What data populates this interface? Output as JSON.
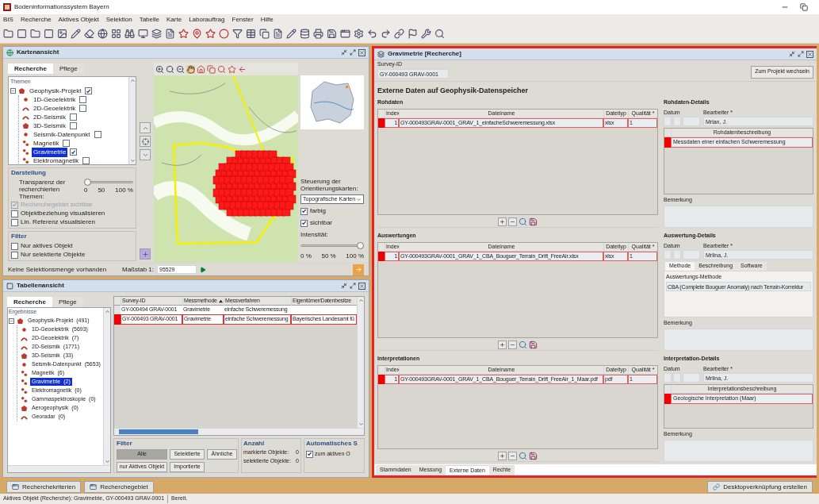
{
  "window": {
    "title": "Bodeninformationssystem Bayern"
  },
  "menu": [
    "BIS",
    "Recherche",
    "Aktives Objekt",
    "Selektion",
    "Tabelle",
    "Karte",
    "Laborauftrag",
    "Fenster",
    "Hilfe"
  ],
  "map_view": {
    "title": "Kartenansicht",
    "tabs": [
      {
        "label": "Recherche",
        "selected": true
      },
      {
        "label": "Pflege",
        "selected": false
      }
    ],
    "themes_label": "Themen",
    "themes": [
      {
        "label": "Geophysik-Projekt",
        "checked": true,
        "selected": false,
        "children": [
          {
            "label": "1D-Geoelektrik",
            "checked": false,
            "selected": false
          },
          {
            "label": "2D-Geoelektrik",
            "checked": false,
            "selected": false
          },
          {
            "label": "2D-Seismik",
            "checked": false,
            "selected": false
          },
          {
            "label": "3D-Seismik",
            "checked": false,
            "selected": false
          },
          {
            "label": "Seismik-Datenpunkt",
            "checked": false,
            "selected": false
          },
          {
            "label": "Magnetik",
            "checked": false,
            "selected": false
          },
          {
            "label": "Gravimetrie",
            "checked": true,
            "selected": true
          },
          {
            "label": "Elektromagnetik",
            "checked": false,
            "selected": false
          }
        ]
      }
    ],
    "display": {
      "title": "Darstellung",
      "transparency": {
        "label": "Transparenz der recherchierten Themen:",
        "level": 0,
        "ticks": [
          "0",
          "50",
          "100 %"
        ]
      },
      "options": [
        {
          "label": "Recherchegebiet sichtbar",
          "checked": true,
          "disabled": true
        },
        {
          "label": "Objektbeziehung visualisieren",
          "checked": false,
          "disabled": false
        },
        {
          "label": "Lin. Referenz visualisieren",
          "checked": false,
          "disabled": false
        }
      ]
    },
    "filter": {
      "title": "Filter",
      "options": [
        {
          "label": "Nur aktives Objekt",
          "checked": false
        },
        {
          "label": "Nur selektierte Objekte",
          "checked": false
        }
      ]
    },
    "orientation": {
      "label": "Steuerung der Orientierungskarten:",
      "map_type": "Topografische Karten",
      "options": [
        {
          "label": "farbig",
          "checked": true
        },
        {
          "label": "sichtbar",
          "checked": true
        }
      ],
      "intensity": {
        "label": "Intensität:",
        "level": 1,
        "ticks": [
          "0 %",
          "50 %",
          "100 %"
        ]
      }
    },
    "selection_status": "Keine Selektionsmenge vorhanden",
    "scale": {
      "label": "Maßstab 1:",
      "value": "95529"
    }
  },
  "table_view": {
    "title": "Tabellenansicht",
    "tabs": [
      {
        "label": "Recherche",
        "selected": true
      },
      {
        "label": "Pflege",
        "selected": false
      }
    ],
    "results_label": "Ergebnisse",
    "tree": [
      {
        "label": "Geophysik-Projekt",
        "count": "(491)",
        "selected": false,
        "children": [
          {
            "label": "1D-Geoelektrik",
            "count": "(5693)",
            "selected": false
          },
          {
            "label": "2D-Geoelektrik",
            "count": "(7)",
            "selected": false
          },
          {
            "label": "2D-Seismik",
            "count": "(1771)",
            "selected": false
          },
          {
            "label": "3D-Seismik",
            "count": "(33)",
            "selected": false
          },
          {
            "label": "Seismik-Datenpunkt",
            "count": "(5653)",
            "selected": false
          },
          {
            "label": "Magnetik",
            "count": "(6)",
            "selected": false
          },
          {
            "label": "Gravimetrie",
            "count": "(2)",
            "selected": true
          },
          {
            "label": "Elektromagnetik",
            "count": "(0)",
            "selected": false
          },
          {
            "label": "Gammaspektroskopie",
            "count": "(0)",
            "selected": false
          },
          {
            "label": "Aerogeophysik",
            "count": "(0)",
            "selected": false
          },
          {
            "label": "Georadar",
            "count": "(0)",
            "selected": false
          }
        ]
      }
    ],
    "table": {
      "columns": [
        {
          "label": "Survey-ID",
          "sorted": false
        },
        {
          "label": "Messmethode",
          "sorted": true
        },
        {
          "label": "Messverfahren",
          "sorted": false
        },
        {
          "label": "Eigentümer/Datenbesitze",
          "sorted": false
        }
      ],
      "rows": [
        {
          "active": false,
          "survey_id": "GY-000494 GRAV-0001",
          "method": "Gravimetrie",
          "procedure": "einfache Schweremessung"
        },
        {
          "active": true,
          "survey_id": "GY-000493 GRAV-0001",
          "method": "Gravimetrie",
          "procedure": "einfache Schweremessung",
          "owner": "Bayerisches Landesamt fü"
        }
      ]
    },
    "filter": {
      "title": "Filter",
      "buttons": [
        {
          "label": "Alle",
          "selected": true
        },
        {
          "label": "Selektierte",
          "selected": false
        },
        {
          "label": "Ähnliche",
          "selected": false
        },
        {
          "label": "nur Aktives Objekt",
          "selected": false
        },
        {
          "label": "Importierte",
          "selected": false
        }
      ]
    },
    "count": {
      "title": "Anzahl",
      "items": [
        {
          "label": "markierte Objekte:",
          "value": "0"
        },
        {
          "label": "selektierte Objekte:",
          "value": "0"
        }
      ]
    },
    "auto": {
      "title": "Automatisches S",
      "option": {
        "label": "zum aktiven O",
        "checked": true
      }
    }
  },
  "detail": {
    "title": "Gravimetrie [Recherche]",
    "survey_id_label": "Survey-ID",
    "survey_id": "GY-000493 GRAV-0001",
    "project_button": "Zum Projekt wechseln",
    "heading": "Externe Daten auf Geophysik-Datenspeicher",
    "sections": [
      {
        "title": "Rohdaten",
        "columns": [
          "Index",
          "Dateiname",
          "Dateityp",
          "Qualität *"
        ],
        "rows": [
          {
            "active": true,
            "cells": [
              "1",
              "GY-000493GRAV-0001_GRAV_1_einfacheSchweremessung.xlsx",
              "xlsx",
              "1"
            ]
          }
        ],
        "details": {
          "kind": "description",
          "title": "Rohdaten-Details",
          "date_label": "Datum",
          "editor_label": "Bearbeiter *",
          "editor": "Mrlan, J.",
          "table_header": "Rohdatenbeschreibung",
          "rows": [
            {
              "active": true,
              "text": "Messdaten einer einfachen Schweremessung"
            }
          ],
          "remark_label": "Bemerkung"
        }
      },
      {
        "title": "Auswertungen",
        "columns": [
          "Index",
          "Dateiname",
          "Dateityp",
          "Qualität *"
        ],
        "rows": [
          {
            "active": true,
            "cells": [
              "1",
              "GY-000493GRAV-0001_GRAV_1_CBA_Bouguer_Terrain_Drift_FreeAir.xlsx",
              "xlsx",
              "1"
            ]
          }
        ],
        "details": {
          "kind": "method",
          "title": "Auswertung-Details",
          "date_label": "Datum",
          "editor_label": "Bearbeiter *",
          "editor": "Mrlina, J.",
          "tabs": [
            {
              "label": "Methode",
              "selected": true
            },
            {
              "label": "Beschreibung",
              "selected": false
            },
            {
              "label": "Software",
              "selected": false
            }
          ],
          "method_label": "Auswertungs-Methode",
          "method": "CBA (Complete Bouguer Anomaly) nach Terrain-Korrektur",
          "remark_label": "Bemerkung"
        }
      },
      {
        "title": "Interpretationen",
        "columns": [
          "Index",
          "Dateiname",
          "Dateityp",
          "Qualität *"
        ],
        "rows": [
          {
            "active": true,
            "cells": [
              "1",
              "GY-000493GRAV-0001_GRAV_1_CBA_Bouguer_Terrain_Drift_FreeAir_1_Maar.pdf",
              "pdf",
              "1"
            ]
          }
        ],
        "details": {
          "kind": "description",
          "title": "Interpretation-Details",
          "date_label": "Datum",
          "editor_label": "Bearbeiter *",
          "editor": "Mrlina, J.",
          "table_header": "Interpretationsbeschreibung",
          "rows": [
            {
              "active": true,
              "text": "Geologische Interpretation (Maar)"
            }
          ],
          "remark_label": "Bemerkung"
        }
      }
    ],
    "tabs": [
      {
        "label": "Stammdaten",
        "selected": false
      },
      {
        "label": "Messung",
        "selected": false
      },
      {
        "label": "Externe Daten",
        "selected": true
      },
      {
        "label": "Rechte",
        "selected": false
      }
    ]
  },
  "bottom_tabs": [
    "Recherchekriterien",
    "Recherchegebiet"
  ],
  "shortcut_button": "Desktopverknüpfung erstellen",
  "status": {
    "object": "Aktives Objekt (Recherche): Gravimetrie, GY-000493 GRAV-0001",
    "state": "Bereit."
  }
}
